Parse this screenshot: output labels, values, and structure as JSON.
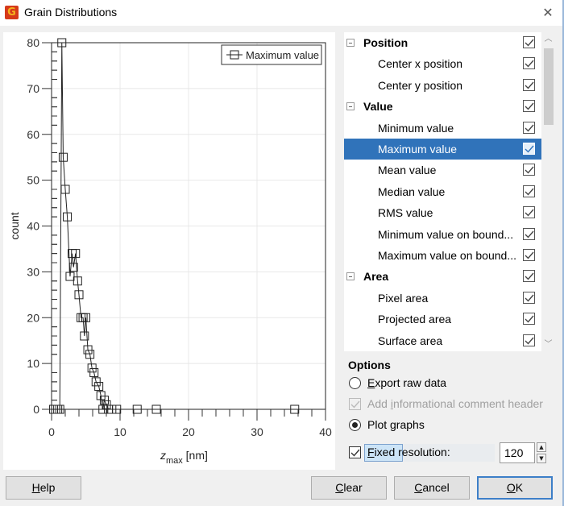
{
  "window": {
    "title": "Grain Distributions",
    "app_icon": "gwyddion-icon",
    "close_icon": "close-icon"
  },
  "chart_data": {
    "type": "line",
    "title": "",
    "xlabel": "z_max [nm]",
    "xlabel_base": "z",
    "xlabel_sub": "max",
    "xlabel_unit": "[nm]",
    "ylabel": "count",
    "xlim": [
      0,
      40
    ],
    "ylim": [
      0,
      80
    ],
    "x_ticks": [
      0,
      10,
      20,
      30,
      40
    ],
    "y_ticks": [
      0,
      10,
      20,
      30,
      40,
      50,
      60,
      70,
      80
    ],
    "grid": true,
    "legend_position": "top-right",
    "series": [
      {
        "name": "Maximum value",
        "marker": "open-square",
        "points": [
          [
            0.3,
            0
          ],
          [
            0.6,
            0
          ],
          [
            0.9,
            0
          ],
          [
            1.2,
            0
          ],
          [
            1.5,
            80
          ],
          [
            1.7,
            55
          ],
          [
            2.0,
            48
          ],
          [
            2.3,
            42
          ],
          [
            2.7,
            29
          ],
          [
            3.0,
            34
          ],
          [
            3.2,
            31
          ],
          [
            3.5,
            34
          ],
          [
            3.8,
            28
          ],
          [
            4.0,
            25
          ],
          [
            4.3,
            20
          ],
          [
            4.6,
            20
          ],
          [
            4.8,
            16
          ],
          [
            5.0,
            20
          ],
          [
            5.3,
            13
          ],
          [
            5.6,
            12
          ],
          [
            5.9,
            9
          ],
          [
            6.2,
            8
          ],
          [
            6.5,
            6
          ],
          [
            6.9,
            5
          ],
          [
            7.2,
            3
          ],
          [
            7.5,
            0
          ],
          [
            7.7,
            2
          ],
          [
            8.0,
            1
          ],
          [
            8.3,
            0
          ],
          [
            8.8,
            0
          ],
          [
            9.5,
            0
          ],
          [
            12.5,
            0
          ],
          [
            15.3,
            0
          ],
          [
            35.5,
            0
          ]
        ]
      }
    ]
  },
  "tree": {
    "rows": [
      {
        "type": "group",
        "label": "Position",
        "checked": true
      },
      {
        "type": "item",
        "label": "Center x position",
        "checked": true
      },
      {
        "type": "item",
        "label": "Center y position",
        "checked": true
      },
      {
        "type": "group",
        "label": "Value",
        "checked": true
      },
      {
        "type": "item",
        "label": "Minimum value",
        "checked": true
      },
      {
        "type": "item",
        "label": "Maximum value",
        "checked": true,
        "selected": true
      },
      {
        "type": "item",
        "label": "Mean value",
        "checked": true
      },
      {
        "type": "item",
        "label": "Median value",
        "checked": true
      },
      {
        "type": "item",
        "label": "RMS value",
        "checked": true
      },
      {
        "type": "item",
        "label": "Minimum value on bound...",
        "checked": true
      },
      {
        "type": "item",
        "label": "Maximum value on bound...",
        "checked": true
      },
      {
        "type": "group",
        "label": "Area",
        "checked": true
      },
      {
        "type": "item",
        "label": "Pixel area",
        "checked": true
      },
      {
        "type": "item",
        "label": "Projected area",
        "checked": true
      },
      {
        "type": "item",
        "label": "Surface area",
        "checked": true
      }
    ]
  },
  "options": {
    "title": "Options",
    "export_raw": {
      "label_mnemonic": "E",
      "label_rest": "xport raw data",
      "selected": false
    },
    "add_header": {
      "label_pre": "Add ",
      "label_mnemonic": "i",
      "label_rest": "nformational comment header",
      "checked": true,
      "disabled": true
    },
    "plot_graphs": {
      "label": "Plot graphs",
      "selected": true
    },
    "fixed_resolution": {
      "label_mnemonic": "F",
      "label_rest": "ixed resolution:",
      "checked": true,
      "value": "120"
    }
  },
  "buttons": {
    "help": {
      "mnemonic": "H",
      "rest": "elp"
    },
    "clear": {
      "mnemonic": "C",
      "rest": "lear"
    },
    "cancel": {
      "mnemonic": "C",
      "rest": "ancel"
    },
    "ok": {
      "mnemonic": "O",
      "rest": "K"
    }
  }
}
